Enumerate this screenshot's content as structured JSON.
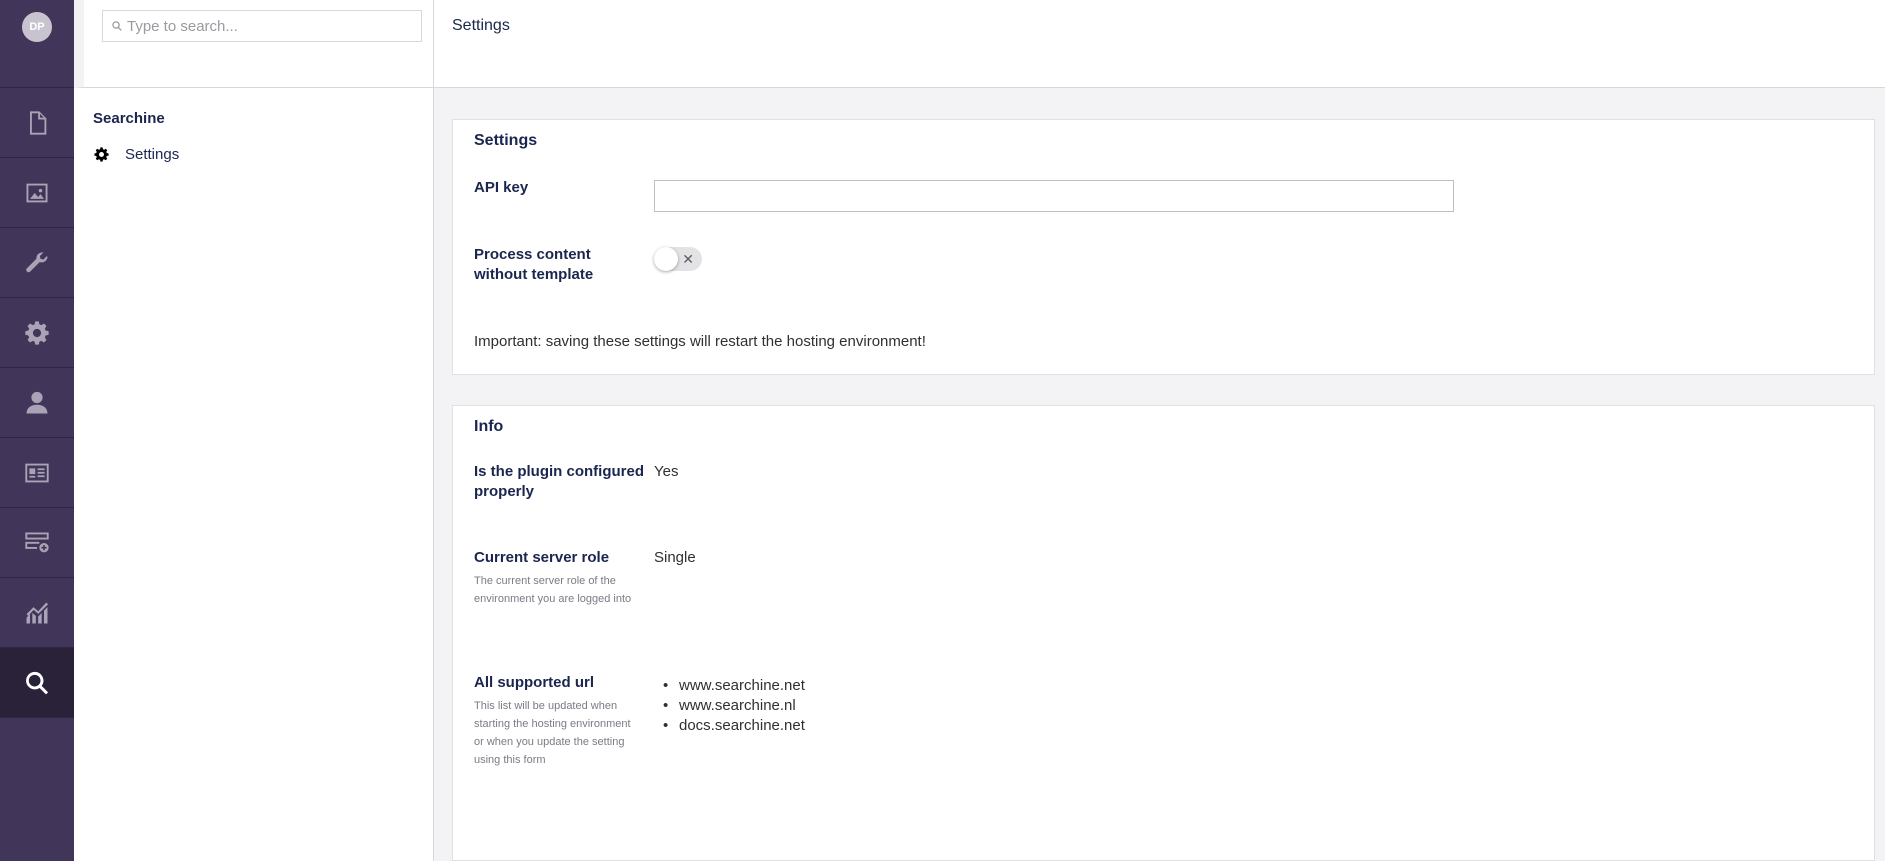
{
  "user": {
    "initials": "DP"
  },
  "sections": [
    {
      "name": "content",
      "icon": "document-icon",
      "active": false
    },
    {
      "name": "media",
      "icon": "image-icon",
      "active": false
    },
    {
      "name": "settings-tools",
      "icon": "wrench-icon",
      "active": false
    },
    {
      "name": "packages",
      "icon": "gear-icon",
      "active": false
    },
    {
      "name": "users",
      "icon": "user-icon",
      "active": false
    },
    {
      "name": "members",
      "icon": "id-card-icon",
      "active": false
    },
    {
      "name": "forms",
      "icon": "server-add-icon",
      "active": false
    },
    {
      "name": "analytics",
      "icon": "chart-icon",
      "active": false
    },
    {
      "name": "searchine",
      "icon": "search-icon",
      "active": true
    }
  ],
  "tree": {
    "search_placeholder": "Type to search...",
    "title": "Searchine",
    "items": [
      {
        "label": "Settings",
        "icon": "gear-icon"
      }
    ]
  },
  "main": {
    "title": "Settings",
    "settings_panel": {
      "title": "Settings",
      "api_key_label": "API key",
      "api_key_value": "",
      "process_label": "Process content without template",
      "process_enabled": false,
      "notice": "Important: saving these settings will restart the hosting environment!"
    },
    "info_panel": {
      "title": "Info",
      "configured_label": "Is the plugin configured properly",
      "configured_value": "Yes",
      "server_role_label": "Current server role",
      "server_role_desc": "The current server role of the environment you are logged into",
      "server_role_value": "Single",
      "urls_label": "All supported url",
      "urls_desc": "This list will be updated when starting the hosting environment or when you update the setting using this form",
      "urls": [
        "www.searchine.net",
        "www.searchine.nl",
        "docs.searchine.net"
      ]
    }
  },
  "colors": {
    "sidebar": "#413659",
    "sidebar_active": "#2a2238",
    "text": "#1b264f"
  }
}
